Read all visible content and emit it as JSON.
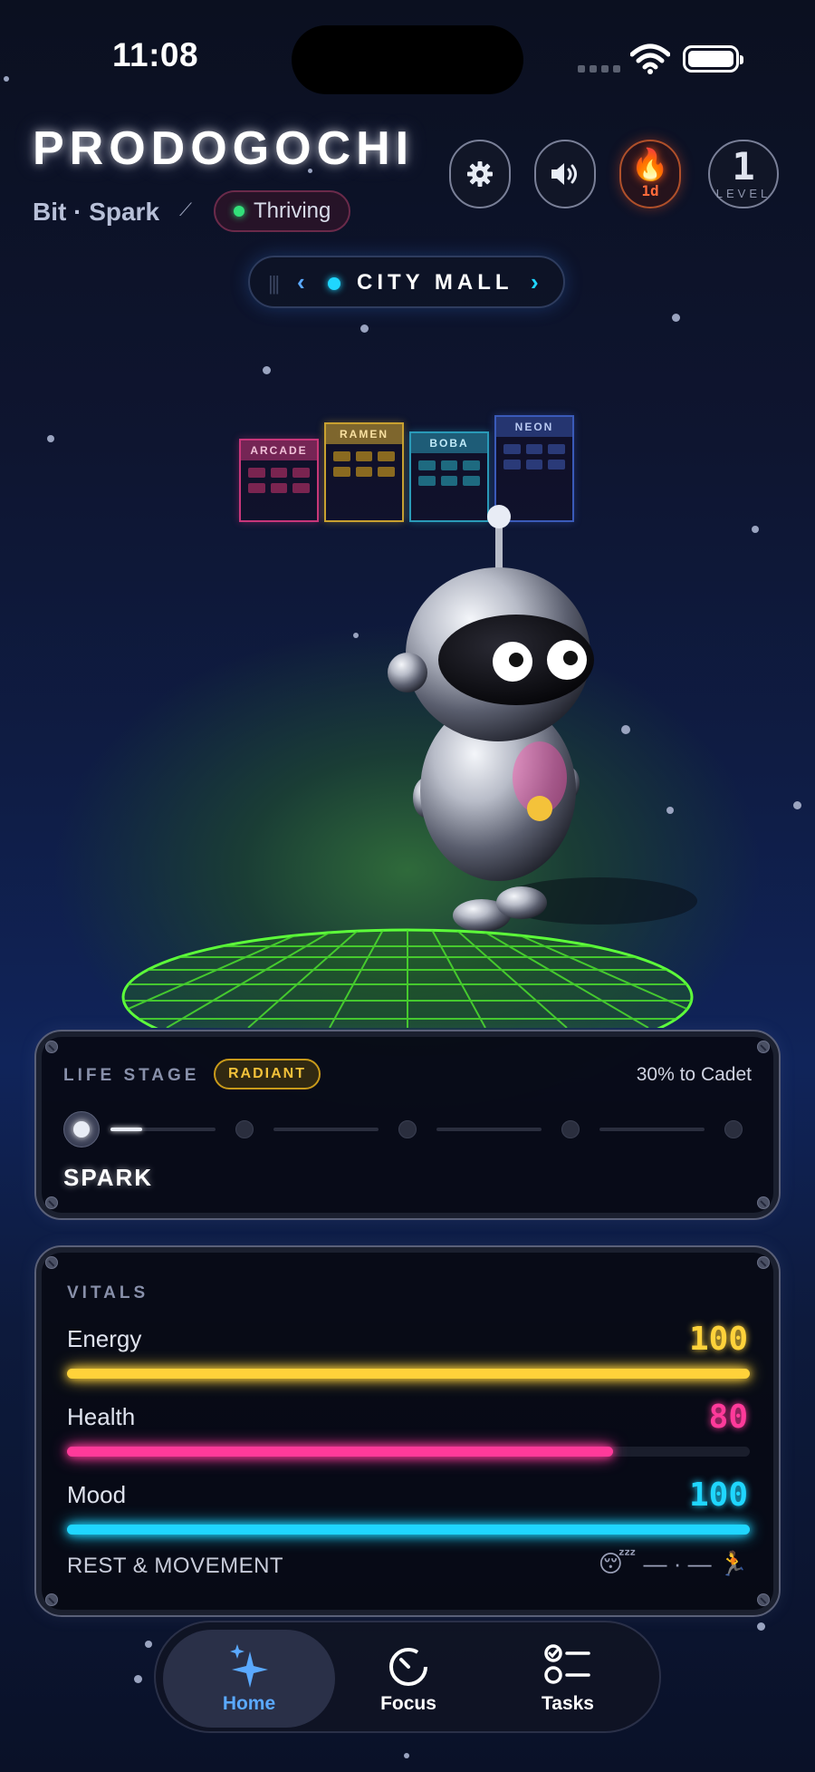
{
  "status_bar": {
    "time": "11:08"
  },
  "header": {
    "app_title": "PRODOGOCHI",
    "pet_subtitle": "Bit · Spark",
    "status_badge": "Thriving",
    "streak_count": "1d",
    "level_number": "1",
    "level_label": "LEVEL"
  },
  "icons": {
    "settings": "gear-icon",
    "sound": "speaker-icon",
    "streak": "flame-icon",
    "edit": "pencil-icon"
  },
  "location": {
    "name": "CITY MALL",
    "shops": [
      "ARCADE",
      "RAMEN",
      "BOBA",
      "NEON"
    ]
  },
  "life_stage": {
    "label": "LIFE STAGE",
    "badge": "RADIANT",
    "progress_text": "30% to Cadet",
    "current_stage": "SPARK",
    "progress_fraction": 0.3,
    "stage_count": 5,
    "current_index": 0
  },
  "vitals": {
    "title": "VITALS",
    "items": [
      {
        "label": "Energy",
        "value": "100",
        "fraction": 1.0,
        "color": "#ffd23a"
      },
      {
        "label": "Health",
        "value": "80",
        "fraction": 0.8,
        "color": "#ff3a9a"
      },
      {
        "label": "Mood",
        "value": "100",
        "fraction": 1.0,
        "color": "#1fd6ff"
      }
    ],
    "rest_movement_label": "REST & MOVEMENT",
    "rest_movement_value": "— · —"
  },
  "tabs": [
    {
      "label": "Home",
      "icon": "sparkles-icon",
      "active": true
    },
    {
      "label": "Focus",
      "icon": "timer-icon",
      "active": false
    },
    {
      "label": "Tasks",
      "icon": "checklist-icon",
      "active": false
    }
  ],
  "colors": {
    "accent_blue": "#5aa9ff",
    "accent_cyan": "#1fd6ff",
    "thriving_green": "#33e07a",
    "radiant_gold": "#f4c23a",
    "platform_green": "#5dff3a"
  }
}
